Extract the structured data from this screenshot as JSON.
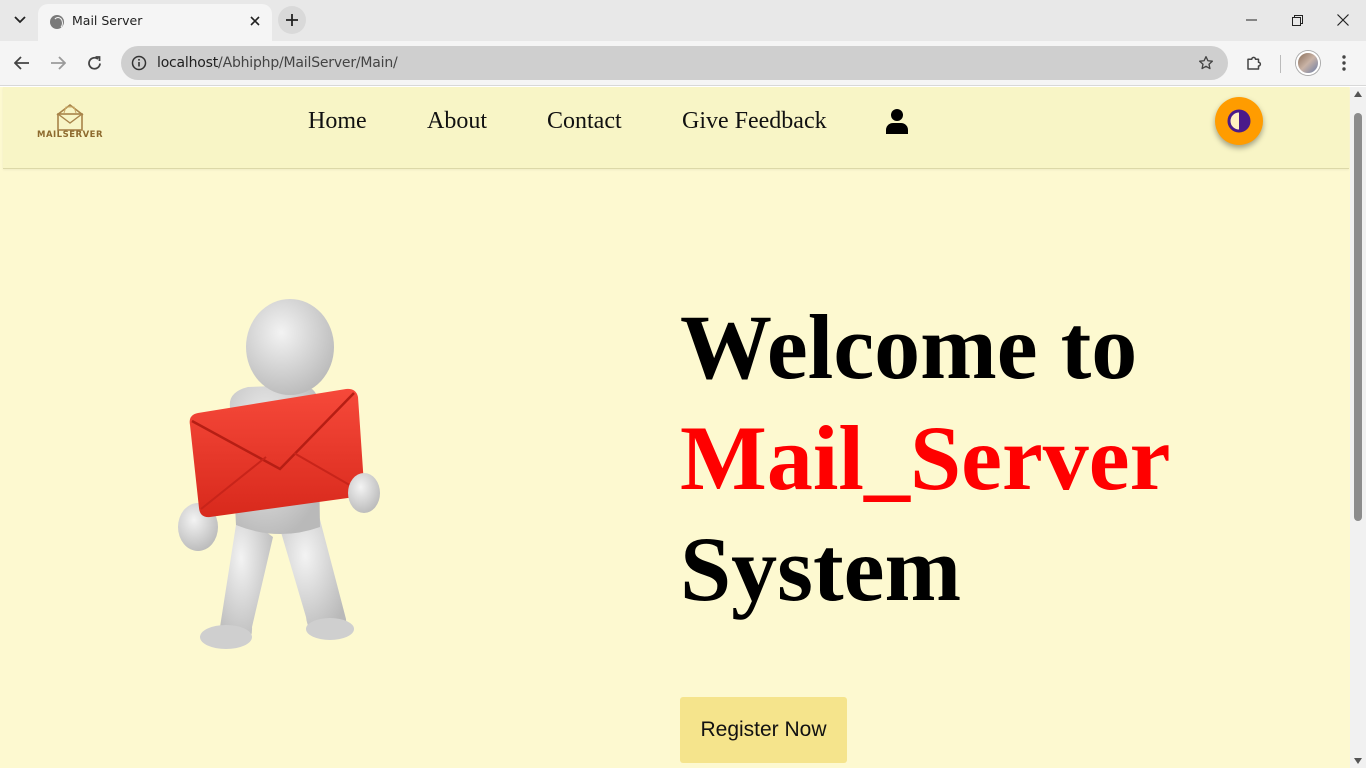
{
  "browser": {
    "tab": {
      "title": "Mail Server"
    },
    "address": {
      "host": "localhost",
      "path": "/Abhiphp/MailServer/Main/"
    }
  },
  "site": {
    "logo": {
      "text": "MAILSERVER"
    },
    "nav": {
      "home": "Home",
      "about": "About",
      "contact": "Contact",
      "feedback": "Give Feedback"
    },
    "theme_color": "#ff9c00",
    "nav_background": "#f8f5c6",
    "page_background": "#fdf9d0"
  },
  "hero": {
    "line1": "Welcome to",
    "line2": "Mail_Server",
    "line3": "System",
    "accent_color": "#ff0000",
    "cta_label": "Register Now",
    "cta_color": "#f5e48c"
  }
}
